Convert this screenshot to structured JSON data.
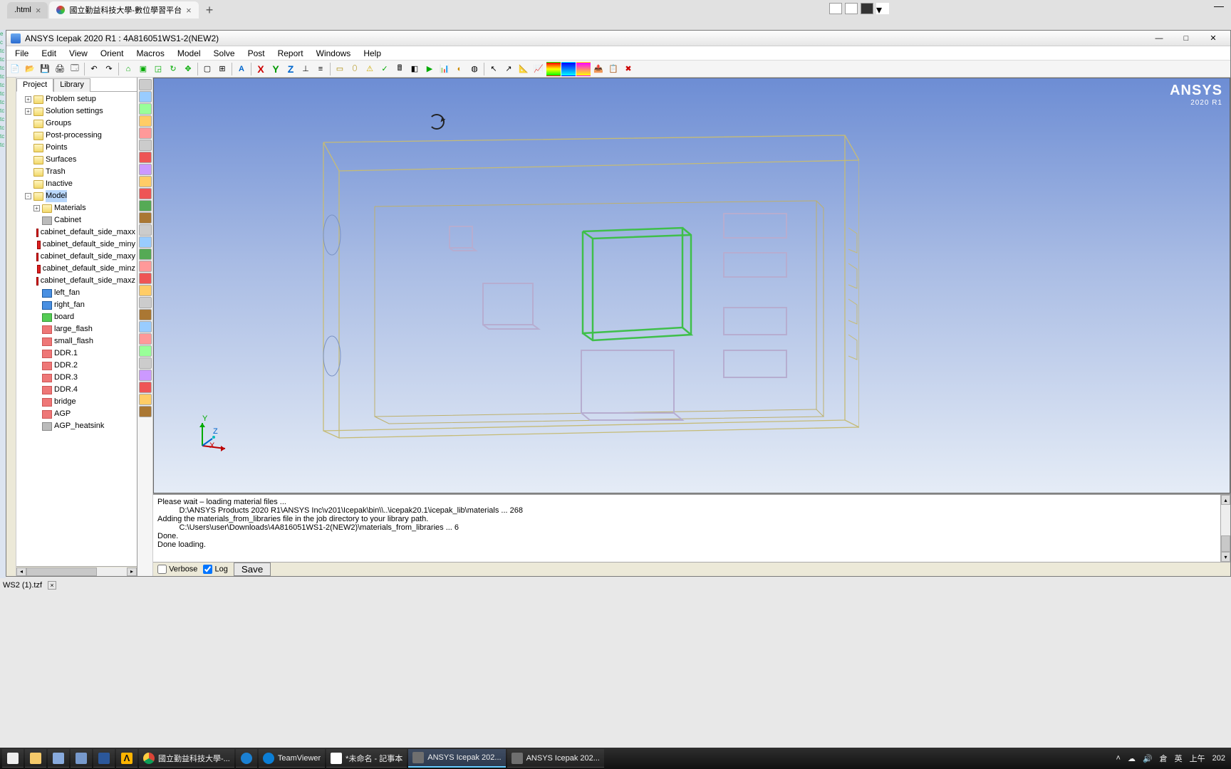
{
  "browser": {
    "tabs": [
      {
        "label": ".html",
        "active": false
      },
      {
        "label": "國立勤益科技大學-數位學習平台",
        "active": true
      }
    ]
  },
  "app": {
    "title": "ANSYS Icepak 2020 R1 : 4A816051WS1-2(NEW2)",
    "watermark": "ANSYS",
    "watermark_sub": "2020 R1"
  },
  "menus": [
    "File",
    "Edit",
    "View",
    "Orient",
    "Macros",
    "Model",
    "Solve",
    "Post",
    "Report",
    "Windows",
    "Help"
  ],
  "axes": {
    "x": "X",
    "y": "Y",
    "z": "Z"
  },
  "triad": {
    "x": "X",
    "y": "Y",
    "z": "Z"
  },
  "panel_tabs": {
    "project": "Project",
    "library": "Library"
  },
  "tree": {
    "items": [
      {
        "label": "Problem setup",
        "indent": 1,
        "icon": "folder",
        "exp": "+"
      },
      {
        "label": "Solution settings",
        "indent": 1,
        "icon": "folder",
        "exp": "+"
      },
      {
        "label": "Groups",
        "indent": 1,
        "icon": "folder",
        "exp": ""
      },
      {
        "label": "Post-processing",
        "indent": 1,
        "icon": "folder",
        "exp": ""
      },
      {
        "label": "Points",
        "indent": 1,
        "icon": "folder",
        "exp": ""
      },
      {
        "label": "Surfaces",
        "indent": 1,
        "icon": "folder",
        "exp": ""
      },
      {
        "label": "Trash",
        "indent": 1,
        "icon": "folder",
        "exp": ""
      },
      {
        "label": "Inactive",
        "indent": 1,
        "icon": "folder",
        "exp": ""
      },
      {
        "label": "Model",
        "indent": 1,
        "icon": "folder",
        "exp": "-",
        "selected": true
      },
      {
        "label": "Materials",
        "indent": 2,
        "icon": "folder",
        "exp": "+"
      },
      {
        "label": "Cabinet",
        "indent": 2,
        "icon": "leaf-grey",
        "exp": ""
      },
      {
        "label": "cabinet_default_side_maxx",
        "indent": 2,
        "icon": "leaf-red",
        "exp": ""
      },
      {
        "label": "cabinet_default_side_miny",
        "indent": 2,
        "icon": "leaf-red",
        "exp": ""
      },
      {
        "label": "cabinet_default_side_maxy",
        "indent": 2,
        "icon": "leaf-red",
        "exp": ""
      },
      {
        "label": "cabinet_default_side_minz",
        "indent": 2,
        "icon": "leaf-red",
        "exp": ""
      },
      {
        "label": "cabinet_default_side_maxz",
        "indent": 2,
        "icon": "leaf-red",
        "exp": ""
      },
      {
        "label": "left_fan",
        "indent": 2,
        "icon": "leaf-blue",
        "exp": ""
      },
      {
        "label": "right_fan",
        "indent": 2,
        "icon": "leaf-blue",
        "exp": ""
      },
      {
        "label": "board",
        "indent": 2,
        "icon": "leaf-green",
        "exp": ""
      },
      {
        "label": "large_flash",
        "indent": 2,
        "icon": "leaf-lred",
        "exp": ""
      },
      {
        "label": "small_flash",
        "indent": 2,
        "icon": "leaf-lred",
        "exp": ""
      },
      {
        "label": "DDR.1",
        "indent": 2,
        "icon": "leaf-lred",
        "exp": ""
      },
      {
        "label": "DDR.2",
        "indent": 2,
        "icon": "leaf-lred",
        "exp": ""
      },
      {
        "label": "DDR.3",
        "indent": 2,
        "icon": "leaf-lred",
        "exp": ""
      },
      {
        "label": "DDR.4",
        "indent": 2,
        "icon": "leaf-lred",
        "exp": ""
      },
      {
        "label": "bridge",
        "indent": 2,
        "icon": "leaf-lred",
        "exp": ""
      },
      {
        "label": "AGP",
        "indent": 2,
        "icon": "leaf-lred",
        "exp": ""
      },
      {
        "label": "AGP_heatsink",
        "indent": 2,
        "icon": "leaf-grey",
        "exp": ""
      }
    ]
  },
  "console": {
    "lines": [
      "Please wait – loading material files ...",
      "          D:\\ANSYS Products 2020 R1\\ANSYS Inc\\v201\\Icepak\\bin\\\\..\\icepak20.1\\icepak_lib\\materials ... 268",
      "Adding the materials_from_libraries file in the job directory to your library path.",
      "          C:\\Users\\user\\Downloads\\4A816051WS1-2(NEW2)\\materials_from_libraries ... 6",
      "Done.",
      "Done loading."
    ],
    "verbose_label": "Verbose",
    "log_label": "Log",
    "save_label": "Save",
    "verbose_checked": false,
    "log_checked": true
  },
  "file_peek": {
    "name": "WS2 (1).tzf"
  },
  "taskbar": {
    "items": [
      {
        "name": "start",
        "ico": "start",
        "label": ""
      },
      {
        "name": "explorer",
        "ico": "fold",
        "label": ""
      },
      {
        "name": "app1",
        "ico": "app1",
        "label": ""
      },
      {
        "name": "app2",
        "ico": "app2",
        "label": ""
      },
      {
        "name": "word",
        "ico": "word",
        "label": ""
      },
      {
        "name": "ansys-wb",
        "ico": "ansys",
        "label": ""
      },
      {
        "name": "chrome",
        "ico": "chrome",
        "label": "國立勤益科技大學-...",
        "active": false
      },
      {
        "name": "edge",
        "ico": "edge",
        "label": ""
      },
      {
        "name": "teamviewer",
        "ico": "tv",
        "label": "TeamViewer",
        "active": false
      },
      {
        "name": "notepad",
        "ico": "note",
        "label": "*未命名 - 記事本",
        "active": false
      },
      {
        "name": "icepak1",
        "ico": "ice",
        "label": "ANSYS Icepak 202...",
        "active": true
      },
      {
        "name": "icepak2",
        "ico": "ice",
        "label": "ANSYS Icepak 202...",
        "active": false
      }
    ],
    "tray": {
      "ime1": "倉",
      "ime2": "英",
      "time": "上午",
      "year": "202"
    }
  }
}
